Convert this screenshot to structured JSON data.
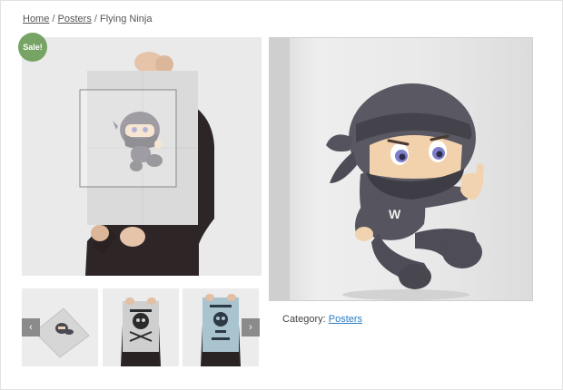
{
  "breadcrumb": {
    "home": "Home",
    "separator": "/",
    "category": "Posters",
    "current": "Flying Ninja"
  },
  "product": {
    "sale_badge": "Sale!",
    "category_label": "Category:",
    "category_link": "Posters",
    "poster_letter": "W"
  },
  "thumbnail_nav": {
    "prev_icon": "chevron-left-icon",
    "next_icon": "chevron-right-icon",
    "prev_glyph": "‹",
    "next_glyph": "›"
  },
  "colors": {
    "sale_green": "#77a464",
    "link_blue": "#2a7cc7"
  }
}
